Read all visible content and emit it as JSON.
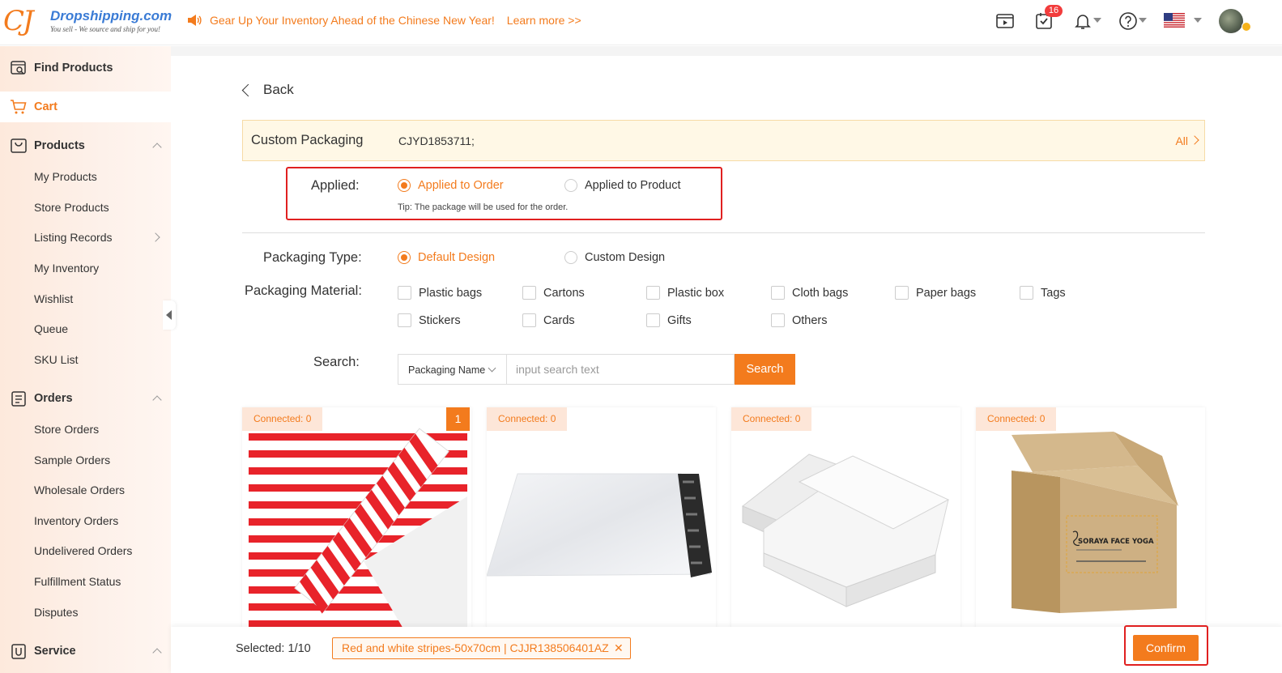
{
  "header": {
    "logo_mark": "CJ",
    "logo_name": "Dropshipping.com",
    "logo_tagline": "You sell - We source and ship for you!",
    "announcement": "Gear Up Your Inventory Ahead of the Chinese New Year!",
    "learn_more": "Learn more >>",
    "task_badge": "16",
    "icons": [
      "video-icon",
      "task-check-icon",
      "bell-icon",
      "help-icon",
      "us-flag-icon",
      "avatar"
    ]
  },
  "sidebar": {
    "find_products": "Find Products",
    "cart": "Cart",
    "products": {
      "label": "Products",
      "items": [
        "My Products",
        "Store Products",
        "Listing Records",
        "My Inventory",
        "Wishlist",
        "Queue",
        "SKU List"
      ]
    },
    "orders": {
      "label": "Orders",
      "items": [
        "Store Orders",
        "Sample Orders",
        "Wholesale Orders",
        "Inventory Orders",
        "Undelivered Orders",
        "Fulfillment Status",
        "Disputes"
      ]
    },
    "service": "Service"
  },
  "main": {
    "back": "Back",
    "custom_packaging": {
      "title": "Custom Packaging",
      "code": "CJYD1853711;",
      "all": "All"
    },
    "applied": {
      "label": "Applied:",
      "options": [
        "Applied to Order",
        "Applied to Product"
      ],
      "selected": "Applied to Order",
      "tip": "Tip: The package will be used for the order."
    },
    "packaging_type": {
      "label": "Packaging Type:",
      "options": [
        "Default Design",
        "Custom Design"
      ],
      "selected": "Default Design"
    },
    "packaging_material": {
      "label": "Packaging Material:",
      "options": [
        "Plastic bags",
        "Cartons",
        "Plastic box",
        "Cloth bags",
        "Paper bags",
        "Tags",
        "Stickers",
        "Cards",
        "Gifts",
        "Others"
      ]
    },
    "search": {
      "label": "Search:",
      "select_value": "Packaging Name",
      "placeholder": "input search text",
      "button": "Search"
    },
    "cards": [
      {
        "connected": "Connected: 0",
        "selected_index": "1",
        "image": "red-white-striped-wrapping-paper"
      },
      {
        "connected": "Connected: 0",
        "image": "white-poly-mailer-bag"
      },
      {
        "connected": "Connected: 0",
        "image": "white-mailer-box"
      },
      {
        "connected": "Connected: 0",
        "image": "kraft-shipping-box-with-logo"
      }
    ],
    "box_logo_text": "SORAYA FACE YOGA"
  },
  "bottom_bar": {
    "selected_label": "Selected:",
    "selected_count": "1/10",
    "selected_item": "Red and white stripes-50x70cm | CJJR138506401AZ",
    "remove": "✕",
    "confirm": "Confirm"
  },
  "colors": {
    "accent": "#f37b1d",
    "highlight_box": "#e02020",
    "notice_bg": "#fff8e6",
    "badge": "#f23c3c"
  }
}
